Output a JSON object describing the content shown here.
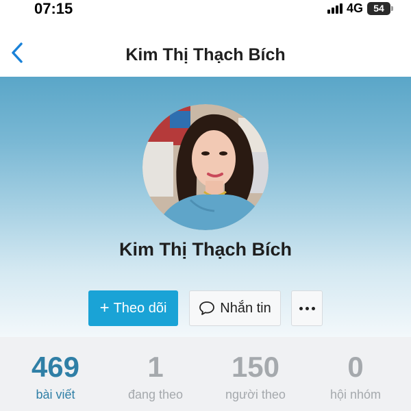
{
  "status_bar": {
    "time": "07:15",
    "network": "4G",
    "battery": "54"
  },
  "header": {
    "title": "Kim Thị Thạch Bích",
    "back_icon": "chevron-left-icon"
  },
  "profile": {
    "name": "Kim Thị Thạch Bích",
    "avatar_icon": "profile-photo"
  },
  "actions": {
    "follow_icon": "+",
    "follow_label": "Theo dõi",
    "message_icon": "chat-bubble-icon",
    "message_label": "Nhắn tin",
    "more_icon": "more-dots-icon"
  },
  "stats": [
    {
      "value": "469",
      "label": "bài viết",
      "active": true
    },
    {
      "value": "1",
      "label": "đang theo",
      "active": false
    },
    {
      "value": "150",
      "label": "người theo",
      "active": false
    },
    {
      "value": "0",
      "label": "hội nhóm",
      "active": false
    }
  ],
  "colors": {
    "accent": "#1aa3d6",
    "active_stat": "#2f7fa6",
    "inactive_stat": "#a5a9ad",
    "back_arrow": "#1a82d8"
  }
}
